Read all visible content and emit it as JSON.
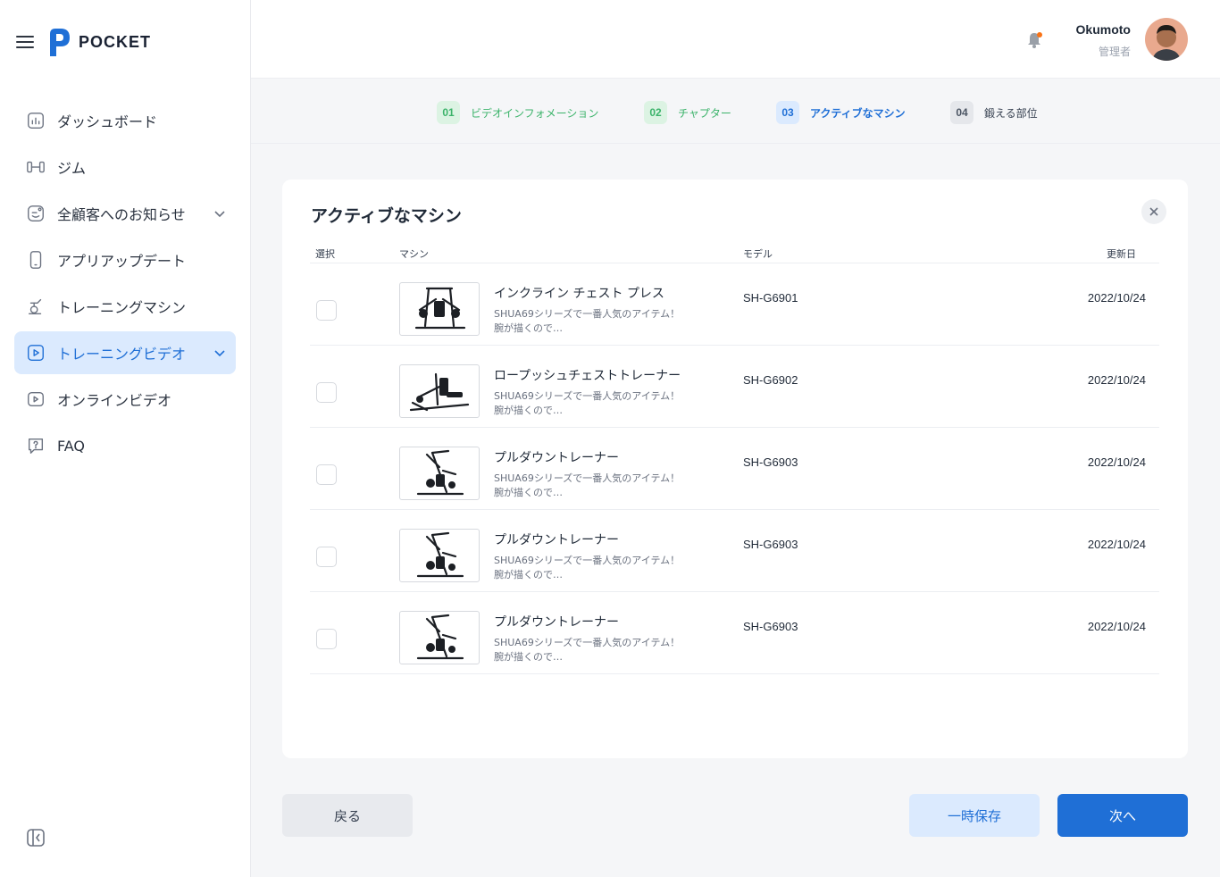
{
  "app": {
    "logo_text": "POCKET"
  },
  "header": {
    "user_name": "Okumoto",
    "user_role": "管理者"
  },
  "sidebar": {
    "items": [
      {
        "label": "ダッシュボード",
        "icon": "dashboard-icon",
        "active": false
      },
      {
        "label": "ジム",
        "icon": "gym-icon",
        "active": false
      },
      {
        "label": "全顧客へのお知らせ",
        "icon": "announcement-icon",
        "active": false,
        "expandable": true
      },
      {
        "label": "アプリアップデート",
        "icon": "phone-icon",
        "active": false
      },
      {
        "label": "トレーニングマシン",
        "icon": "machine-icon",
        "active": false
      },
      {
        "label": "トレーニングビデオ",
        "icon": "video-icon",
        "active": true,
        "expandable": true
      },
      {
        "label": "オンラインビデオ",
        "icon": "online-video-icon",
        "active": false
      },
      {
        "label": "FAQ",
        "icon": "faq-icon",
        "active": false
      }
    ]
  },
  "stepper": {
    "steps": [
      {
        "num": "01",
        "label": "ビデオインフォメーション",
        "state": "done"
      },
      {
        "num": "02",
        "label": "チャプター",
        "state": "done"
      },
      {
        "num": "03",
        "label": "アクティブなマシン",
        "state": "current"
      },
      {
        "num": "04",
        "label": "鍛える部位",
        "state": "todo"
      }
    ]
  },
  "card": {
    "title": "アクティブなマシン",
    "columns": {
      "select": "選択",
      "machine": "マシン",
      "model": "モデル",
      "updated": "更新日"
    },
    "rows": [
      {
        "name": "インクライン チェスト プレス",
        "desc": "SHUA69シリーズで一番人気のアイテム！ 腕が描くので…",
        "model": "SH-G6901",
        "date": "2022/10/24",
        "checked": false
      },
      {
        "name": "ロープッシュチェストトレーナー",
        "desc": "SHUA69シリーズで一番人気のアイテム！ 腕が描くので…",
        "model": "SH-G6902",
        "date": "2022/10/24",
        "checked": false
      },
      {
        "name": "プルダウントレーナー",
        "desc": "SHUA69シリーズで一番人気のアイテム！ 腕が描くので…",
        "model": "SH-G6903",
        "date": "2022/10/24",
        "checked": false
      },
      {
        "name": "プルダウントレーナー",
        "desc": "SHUA69シリーズで一番人気のアイテム！ 腕が描くので…",
        "model": "SH-G6903",
        "date": "2022/10/24",
        "checked": false
      },
      {
        "name": "プルダウントレーナー",
        "desc": "SHUA69シリーズで一番人気のアイテム！ 腕が描くので…",
        "model": "SH-G6903",
        "date": "2022/10/24",
        "checked": false
      }
    ]
  },
  "footer": {
    "back_label": "戻る",
    "save_label": "一時保存",
    "next_label": "次へ"
  },
  "colors": {
    "primary": "#1f6fd6",
    "success": "#3bb36a",
    "notification": "#f97316"
  }
}
